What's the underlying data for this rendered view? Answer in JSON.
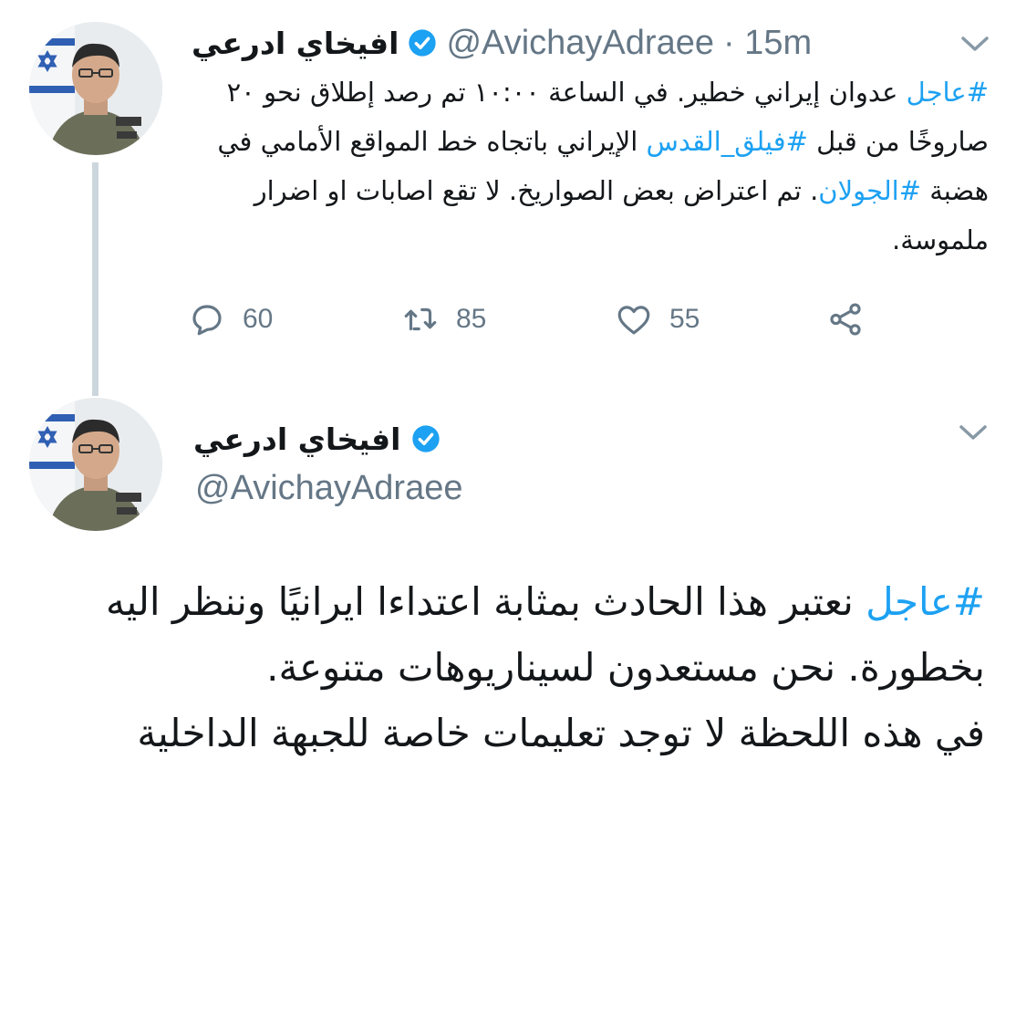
{
  "tweet1": {
    "display_name": "افيخاي ادرعي",
    "handle": "@AvichayAdraee",
    "time": "· 15m",
    "body": [
      {
        "text": "#عاجل",
        "hashtag": true
      },
      {
        "text": " عدوان إيراني خطير. في الساعة ١٠:٠٠ تم رصد إطلاق نحو ٢٠ صاروخًا من قبل ",
        "hashtag": false
      },
      {
        "text": "#فيلق_القدس",
        "hashtag": true
      },
      {
        "text": " الإيراني باتجاه خط المواقع الأمامي في هضبة ",
        "hashtag": false
      },
      {
        "text": "#الجولان",
        "hashtag": true
      },
      {
        "text": ". تم اعتراض بعض الصواريخ. لا تقع اصابات او اضرار ملموسة.",
        "hashtag": false
      }
    ],
    "actions": {
      "replies": "60",
      "retweets": "85",
      "likes": "55"
    }
  },
  "tweet2": {
    "display_name": "افيخاي ادرعي",
    "handle": "@AvichayAdraee",
    "paragraph1": [
      {
        "text": "#عاجل",
        "hashtag": true
      },
      {
        "text": " نعتبر هذا الحادث بمثابة اعتداءا ايرانيًا وننظر اليه بخطورة. نحن مستعدون لسيناريوهات متنوعة.",
        "hashtag": false
      }
    ],
    "paragraph2": "في هذه اللحظة لا توجد تعليمات خاصة للجبهة الداخلية"
  },
  "icons": {
    "verified": "verified-badge-icon",
    "chevron": "chevron-down-icon",
    "reply": "reply-icon",
    "retweet": "retweet-icon",
    "like": "heart-icon",
    "share": "share-icon"
  },
  "colors": {
    "accent": "#1da1f2",
    "muted": "#657786",
    "text": "#14171a",
    "thread_line": "#ccd6dd"
  }
}
